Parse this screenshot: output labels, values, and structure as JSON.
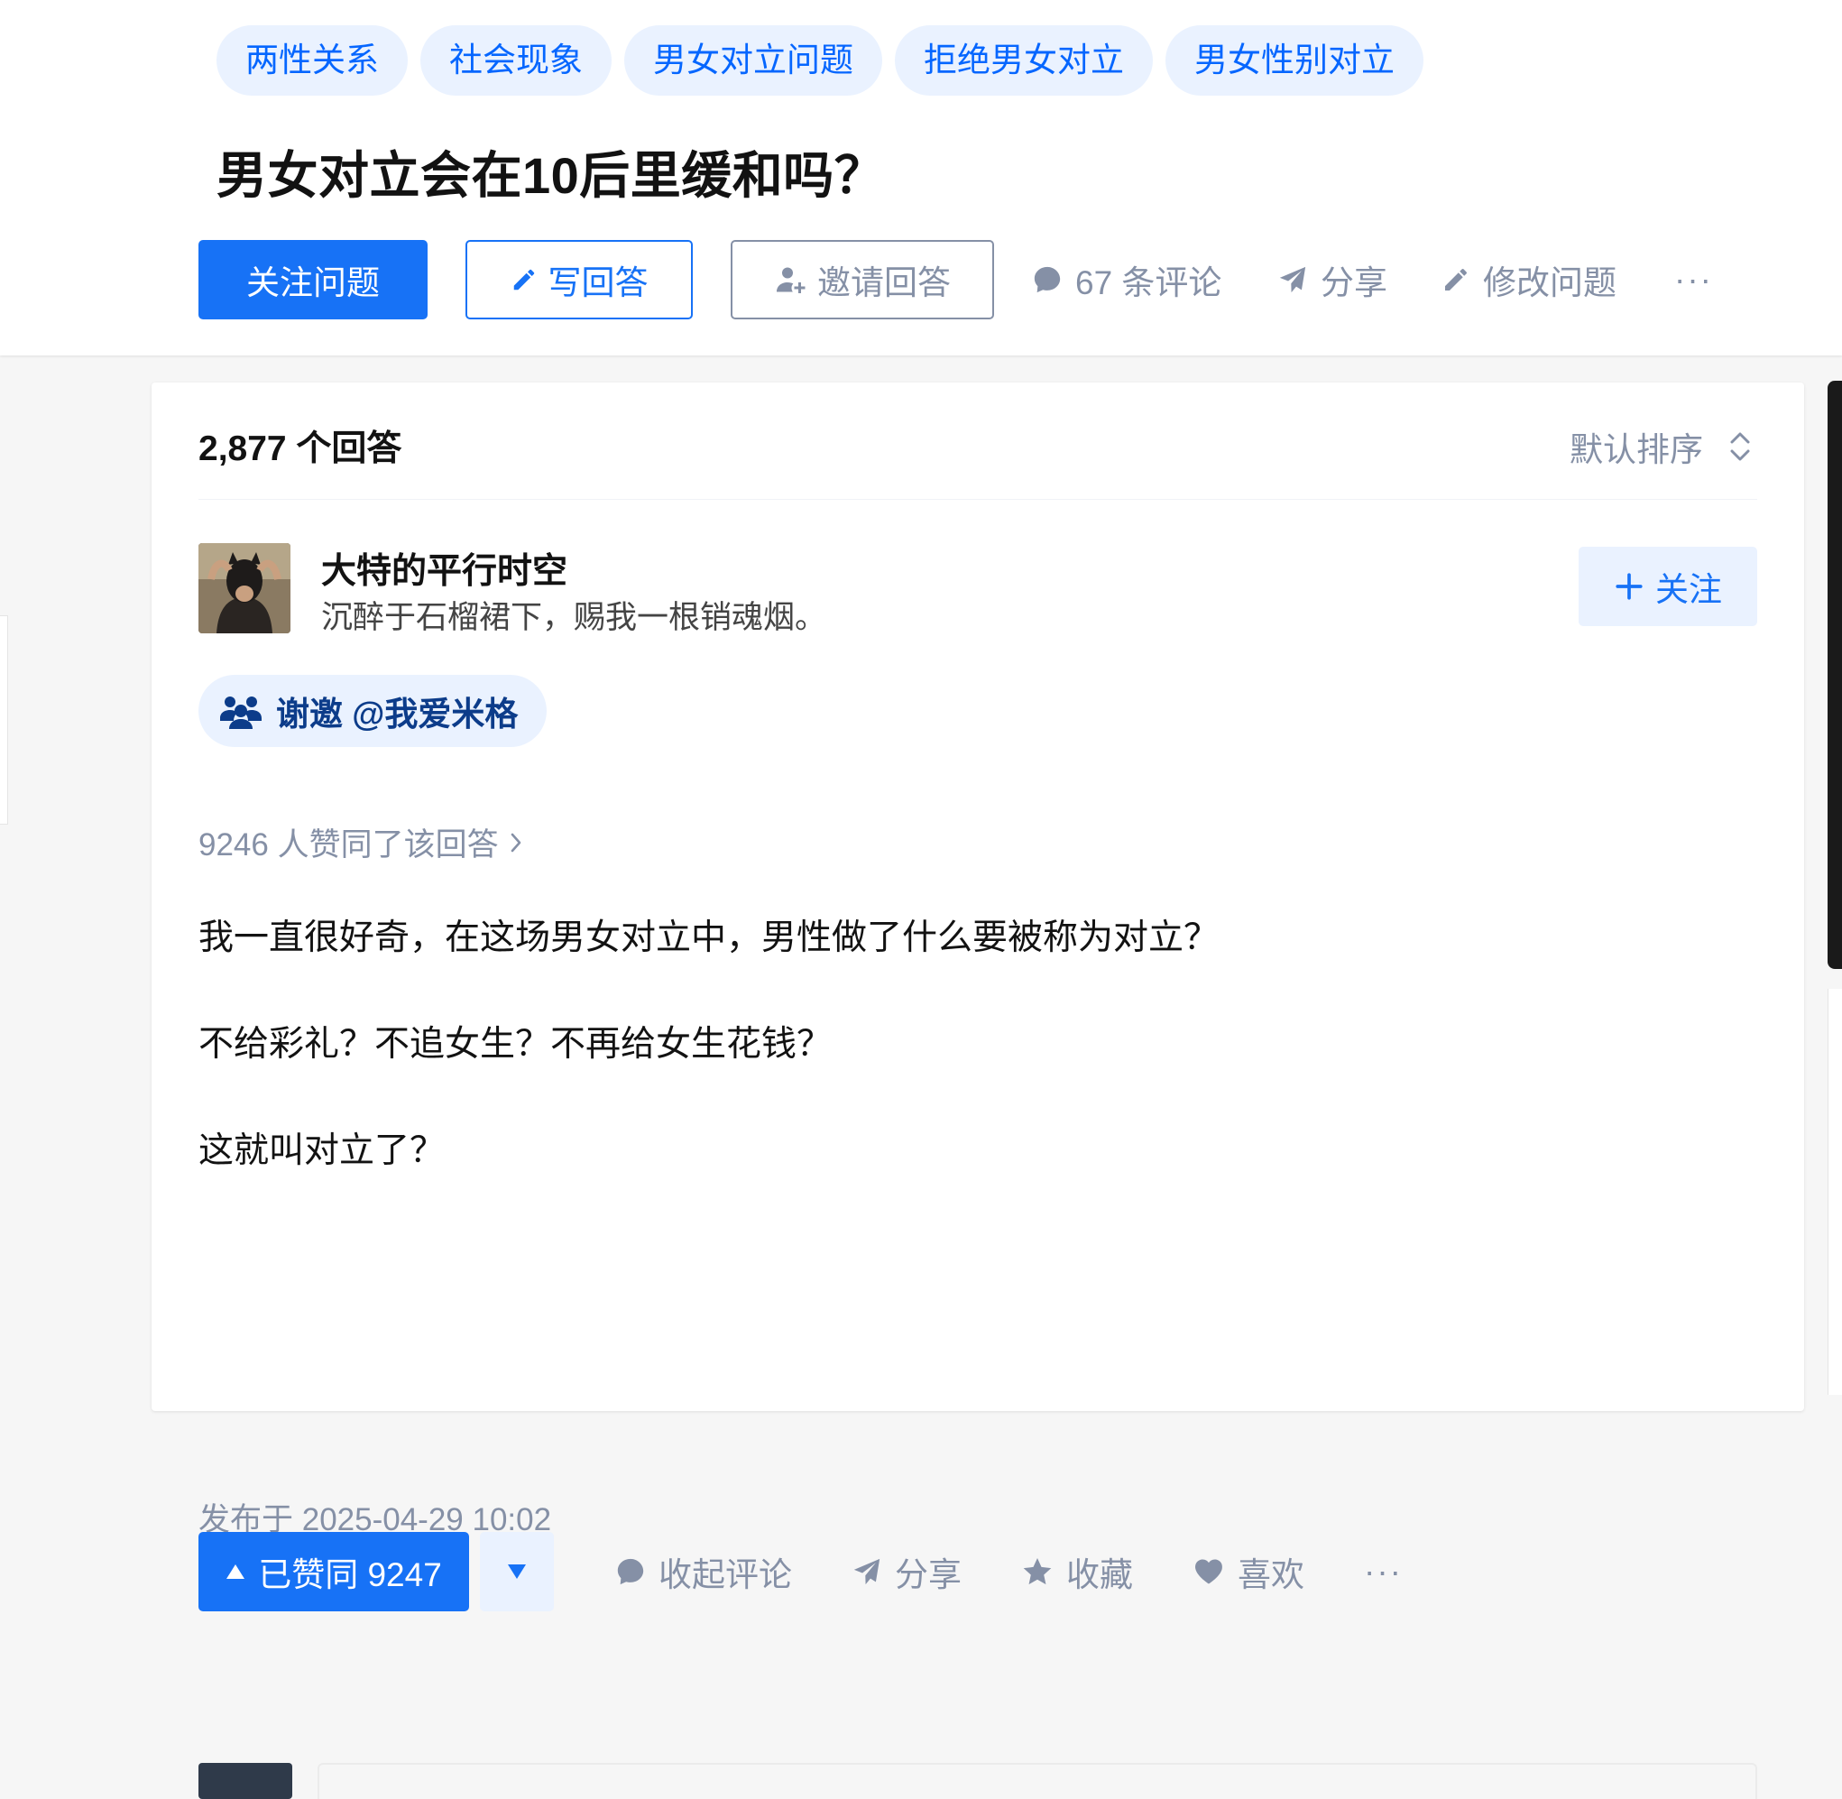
{
  "question": {
    "topics": [
      "两性关系",
      "社会现象",
      "男女对立问题",
      "拒绝男女对立",
      "男女性别对立"
    ],
    "title": "男女对立会在10后里缓和吗？",
    "actions": {
      "follow": "关注问题",
      "write_answer": "写回答",
      "invite": "邀请回答",
      "comments": "67 条评论",
      "share": "分享",
      "edit": "修改问题",
      "more": "···"
    }
  },
  "answers": {
    "count_label": "2,877 个回答",
    "sort_label": "默认排序"
  },
  "answer": {
    "author_name": "大特的平行时空",
    "author_bio": "沉醉于石榴裙下，赐我一根销魂烟。",
    "follow_label": "关注",
    "invite_thanks": "谢邀 @我爱米格",
    "vote_meta": "9246 人赞同了该回答",
    "paragraphs": [
      "我一直很好奇，在这场男女对立中，男性做了什么要被称为对立？",
      "不给彩礼？不追女生？不再给女生花钱？",
      "这就叫对立了？"
    ],
    "published": "发布于 2025-04-29 10:02",
    "actions": {
      "upvote": "已赞同 9247",
      "collapse_comments": "收起评论",
      "share": "分享",
      "collect": "收藏",
      "like": "喜欢",
      "more": "···"
    }
  },
  "colors": {
    "brand_blue": "#1772f6",
    "chip_bg": "#eaf2ff",
    "meta_gray": "#8590a6"
  }
}
